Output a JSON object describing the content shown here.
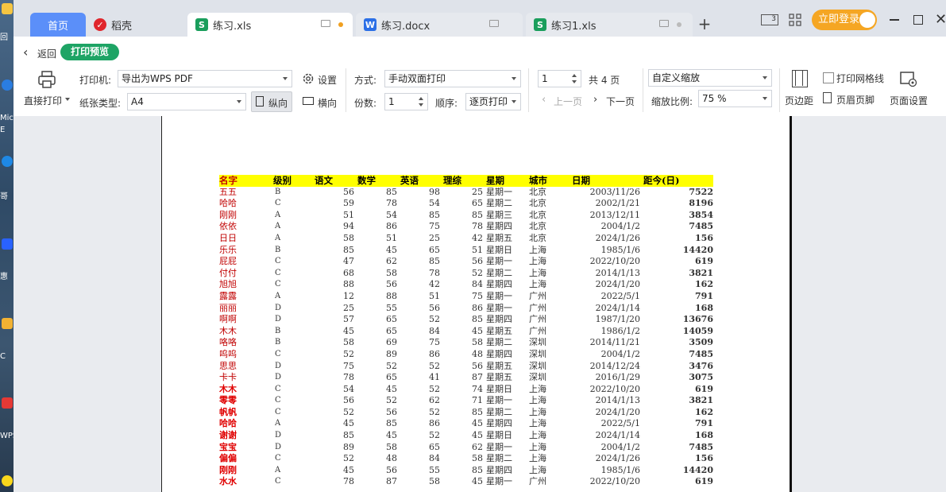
{
  "desktop": {
    "labels": [
      "回",
      "Mic",
      "E",
      "哥",
      "惠",
      "C",
      "WPS",
      ""
    ]
  },
  "tabs": [
    {
      "label": "首页"
    },
    {
      "label": "稻壳",
      "icon": "daoke-icon"
    },
    {
      "label": "练习.xls",
      "icon": "S"
    },
    {
      "label": "练习.docx",
      "icon": "W"
    },
    {
      "label": "练习1.xls",
      "icon": "S"
    }
  ],
  "window": {
    "login_label": "立即登录",
    "page_num_badge": "3"
  },
  "toolbar": {
    "back_label": "返回",
    "print_preview_label": "打印预览",
    "direct_print_label": "直接打印",
    "printer_label": "打印机:",
    "printer_value": "导出为WPS PDF",
    "settings_label": "设置",
    "paper_label": "纸张类型:",
    "paper_value": "A4",
    "portrait_label": "纵向",
    "landscape_label": "横向",
    "mode_label": "方式:",
    "mode_value": "手动双面打印",
    "copies_label": "份数:",
    "copies_value": "1",
    "order_label": "顺序:",
    "order_value": "逐页打印",
    "page_value": "1",
    "total_pages": "共 4 页",
    "prev_page": "上一页",
    "next_page": "下一页",
    "zoom_mode": "自定义缩放",
    "zoom_label": "缩放比例:",
    "zoom_value": "75 %",
    "margins_label": "页边距",
    "gridlines_label": "打印网格线",
    "header_footer_label": "页眉页脚",
    "page_setup_label": "页面设置"
  },
  "sheet": {
    "headers": [
      "名字",
      "级别",
      "语文",
      "数学",
      "英语",
      "理综",
      "星期",
      "城市",
      "日期",
      "距今(日)"
    ],
    "rows": [
      [
        "五五",
        "B",
        "56",
        "85",
        "98",
        "25",
        "星期一",
        "北京",
        "2003/11/26",
        "7522"
      ],
      [
        "哈哈",
        "C",
        "59",
        "78",
        "54",
        "65",
        "星期二",
        "北京",
        "2002/1/21",
        "8196"
      ],
      [
        "刚刚",
        "A",
        "51",
        "54",
        "85",
        "85",
        "星期三",
        "北京",
        "2013/12/11",
        "3854"
      ],
      [
        "依依",
        "A",
        "94",
        "86",
        "75",
        "78",
        "星期四",
        "北京",
        "2004/1/2",
        "7485"
      ],
      [
        "日日",
        "A",
        "58",
        "51",
        "25",
        "42",
        "星期五",
        "北京",
        "2024/1/26",
        "156"
      ],
      [
        "乐乐",
        "B",
        "85",
        "45",
        "65",
        "51",
        "星期日",
        "上海",
        "1985/1/6",
        "14420"
      ],
      [
        "屁屁",
        "C",
        "47",
        "62",
        "85",
        "56",
        "星期一",
        "上海",
        "2022/10/20",
        "619"
      ],
      [
        "付付",
        "C",
        "68",
        "58",
        "78",
        "52",
        "星期二",
        "上海",
        "2014/1/13",
        "3821"
      ],
      [
        "旭旭",
        "C",
        "88",
        "56",
        "42",
        "84",
        "星期四",
        "上海",
        "2024/1/20",
        "162"
      ],
      [
        "露露",
        "A",
        "12",
        "88",
        "51",
        "75",
        "星期一",
        "广州",
        "2022/5/1",
        "791"
      ],
      [
        "丽丽",
        "D",
        "25",
        "55",
        "56",
        "86",
        "星期一",
        "广州",
        "2024/1/14",
        "168"
      ],
      [
        "啊啊",
        "D",
        "57",
        "65",
        "52",
        "85",
        "星期四",
        "广州",
        "1987/1/20",
        "13676"
      ],
      [
        "木木",
        "B",
        "45",
        "65",
        "84",
        "45",
        "星期五",
        "广州",
        "1986/1/2",
        "14059"
      ],
      [
        "咯咯",
        "B",
        "58",
        "69",
        "75",
        "58",
        "星期二",
        "深圳",
        "2014/11/21",
        "3509"
      ],
      [
        "呜呜",
        "C",
        "52",
        "89",
        "86",
        "48",
        "星期四",
        "深圳",
        "2004/1/2",
        "7485"
      ],
      [
        "思思",
        "D",
        "75",
        "52",
        "52",
        "56",
        "星期五",
        "深圳",
        "2014/12/24",
        "3476"
      ],
      [
        "卡卡",
        "D",
        "78",
        "65",
        "41",
        "87",
        "星期五",
        "深圳",
        "2016/1/29",
        "3075"
      ],
      [
        "木木",
        "C",
        "54",
        "45",
        "52",
        "74",
        "星期日",
        "上海",
        "2022/10/20",
        "619"
      ],
      [
        "零零",
        "C",
        "56",
        "52",
        "62",
        "71",
        "星期一",
        "上海",
        "2014/1/13",
        "3821"
      ],
      [
        "帆帆",
        "C",
        "52",
        "56",
        "52",
        "85",
        "星期二",
        "上海",
        "2024/1/20",
        "162"
      ],
      [
        "哈哈",
        "A",
        "45",
        "85",
        "86",
        "45",
        "星期四",
        "上海",
        "2022/5/1",
        "791"
      ],
      [
        "谢谢",
        "D",
        "85",
        "45",
        "52",
        "45",
        "星期日",
        "上海",
        "2024/1/14",
        "168"
      ],
      [
        "宝宝",
        "D",
        "89",
        "58",
        "65",
        "62",
        "星期一",
        "上海",
        "2004/1/2",
        "7485"
      ],
      [
        "偏偏",
        "C",
        "52",
        "48",
        "84",
        "58",
        "星期二",
        "上海",
        "2024/1/26",
        "156"
      ],
      [
        "刚刚",
        "A",
        "45",
        "56",
        "55",
        "85",
        "星期四",
        "上海",
        "1985/1/6",
        "14420"
      ],
      [
        "水水",
        "C",
        "78",
        "87",
        "58",
        "45",
        "星期一",
        "广州",
        "2022/10/20",
        "619"
      ]
    ],
    "bold_name_from_row": 17
  }
}
